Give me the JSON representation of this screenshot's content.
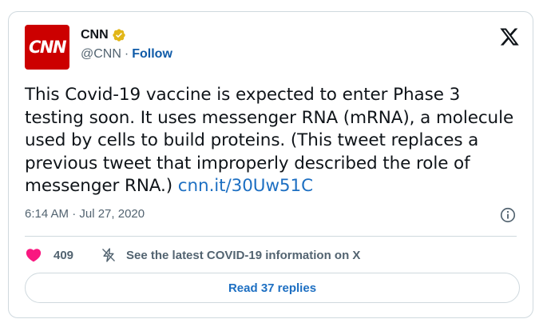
{
  "tweet": {
    "author": {
      "avatar_text": "CNN",
      "name": "CNN",
      "handle": "@CNN",
      "separator": "·",
      "follow_label": "Follow"
    },
    "text": "This Covid-19 vaccine is expected to enter Phase 3 testing soon. It uses messenger RNA (mRNA), a molecule used by cells to build proteins. (This tweet replaces a previous tweet that improperly described the role of messenger RNA.)",
    "link": "cnn.it/30Uw51C",
    "timestamp": "6:14 AM · Jul 27, 2020",
    "likes": "409",
    "covid_info": "See the latest COVID-19 information on X",
    "replies_button": "Read 37 replies"
  },
  "colors": {
    "brand_red": "#cc0000",
    "link_blue": "#1d6fc2",
    "heart": "#f91880",
    "verified_gold": "#e2b719"
  },
  "icons": {
    "verified": "verified-badge-icon",
    "x": "x-logo-icon",
    "info": "info-icon",
    "heart": "heart-icon",
    "bolt": "bolt-icon"
  }
}
